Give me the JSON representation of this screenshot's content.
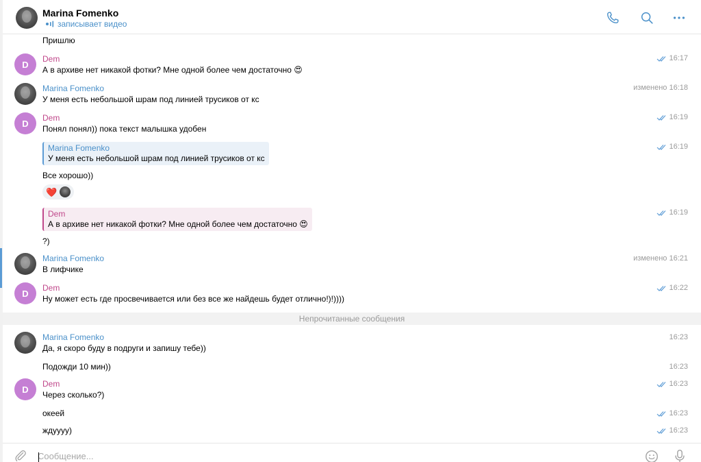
{
  "header": {
    "name": "Marina Fomenko",
    "status": "записывает видео"
  },
  "colors": {
    "accent": "#4a90c9",
    "dem_name": "#c0478a",
    "dem_avatar": "#c57fd4",
    "checks": "#5b9bd5"
  },
  "messages": [
    {
      "id": "m0",
      "text": "Пришлю"
    },
    {
      "id": "m1",
      "sender": "Dem",
      "avatar_letter": "D",
      "text": "А в архиве нет никакой фотки? Мне одной более чем достаточно 😍",
      "time": "16:17",
      "read": true
    },
    {
      "id": "m2",
      "sender": "Marina Fomenko",
      "text": "У меня есть небольшой шрам   под линией трусиков от кс",
      "time": "изменено 16:18"
    },
    {
      "id": "m3",
      "sender": "Dem",
      "avatar_letter": "D",
      "text": "Понял понял)) пока текст малышка удобен",
      "time": "16:19",
      "read": true
    },
    {
      "id": "m4",
      "quote": {
        "name": "Marina Fomenko",
        "text": "У меня есть небольшой шрам   под линией трусиков от кс"
      },
      "text": "Все хорошо))",
      "time": "16:19",
      "read": true,
      "reactions": [
        "❤️"
      ]
    },
    {
      "id": "m5",
      "quote": {
        "name": "Dem",
        "text": "А в архиве нет никакой фотки? Мне одной более чем достаточно 😍"
      },
      "text": "?)",
      "time": "16:19",
      "read": true
    },
    {
      "id": "m6",
      "sender": "Marina Fomenko",
      "text": "В лифчике",
      "time": "изменено 16:21"
    },
    {
      "id": "m7",
      "sender": "Dem",
      "avatar_letter": "D",
      "text": "Ну может есть где просвечивается или без все же найдешь будет отлично!)!))))",
      "time": "16:22",
      "read": true
    },
    {
      "id": "m8",
      "sender": "Marina Fomenko",
      "text": "Да, я скоро буду в подруги и запишу тебе))",
      "time": "16:23"
    },
    {
      "id": "m9",
      "text": "Подожди 10 мин))",
      "time": "16:23"
    },
    {
      "id": "m10",
      "sender": "Dem",
      "avatar_letter": "D",
      "text": "Через сколько?)",
      "time": "16:23",
      "read": true
    },
    {
      "id": "m11",
      "text": "океей",
      "time": "16:23",
      "read": true
    },
    {
      "id": "m12",
      "text": "ждуууу)",
      "time": "16:23",
      "read": true
    }
  ],
  "unread_divider": "Непрочитанные сообщения",
  "composer": {
    "placeholder": "Сообщение..."
  },
  "icons": [
    "phone-icon",
    "search-icon",
    "more-icon",
    "attach-icon",
    "emoji-icon",
    "microphone-icon",
    "double-check-icon",
    "recording-icon"
  ]
}
